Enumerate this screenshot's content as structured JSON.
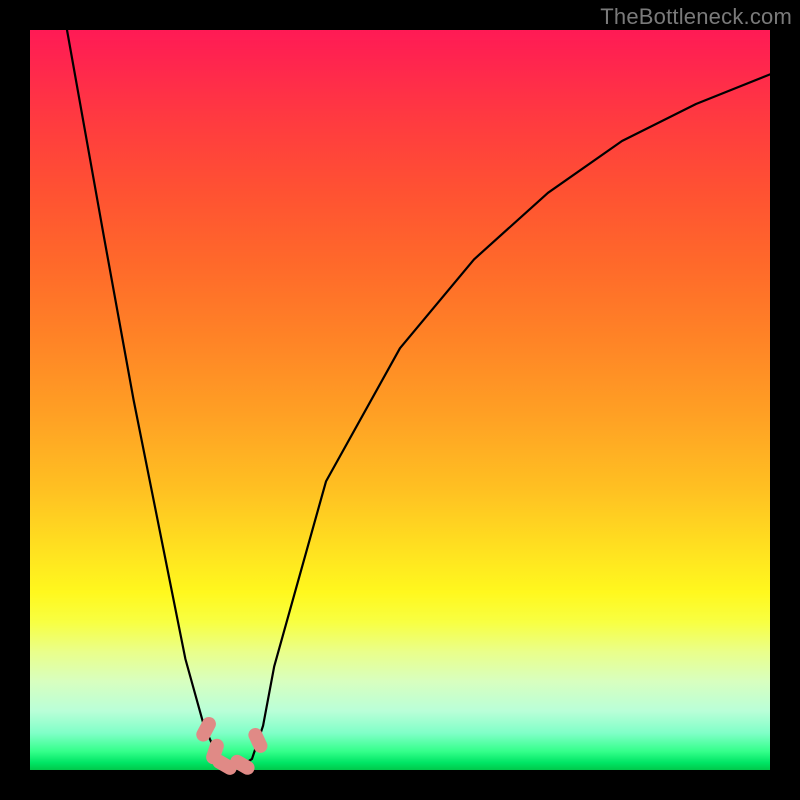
{
  "watermark": "TheBottleneck.com",
  "chart_data": {
    "type": "line",
    "title": "",
    "xlabel": "",
    "ylabel": "",
    "xlim": [
      0,
      100
    ],
    "ylim": [
      0,
      100
    ],
    "series": [
      {
        "name": "curve",
        "x": [
          5,
          10,
          14,
          18,
          21,
          23.5,
          25.5,
          27,
          28.5,
          30,
          31.5,
          33,
          40,
          50,
          60,
          70,
          80,
          90,
          100
        ],
        "values": [
          100,
          72,
          50,
          30,
          15,
          6,
          1.5,
          0.5,
          0.5,
          1.5,
          6,
          14,
          39,
          57,
          69,
          78,
          85,
          90,
          94
        ]
      }
    ],
    "markers": {
      "name": "highlight-points",
      "color": "#e08a86",
      "points": [
        {
          "x": 23.8,
          "y": 5.5
        },
        {
          "x": 25.0,
          "y": 2.5
        },
        {
          "x": 26.3,
          "y": 0.7
        },
        {
          "x": 28.7,
          "y": 0.7
        },
        {
          "x": 30.8,
          "y": 4.0
        }
      ]
    }
  }
}
